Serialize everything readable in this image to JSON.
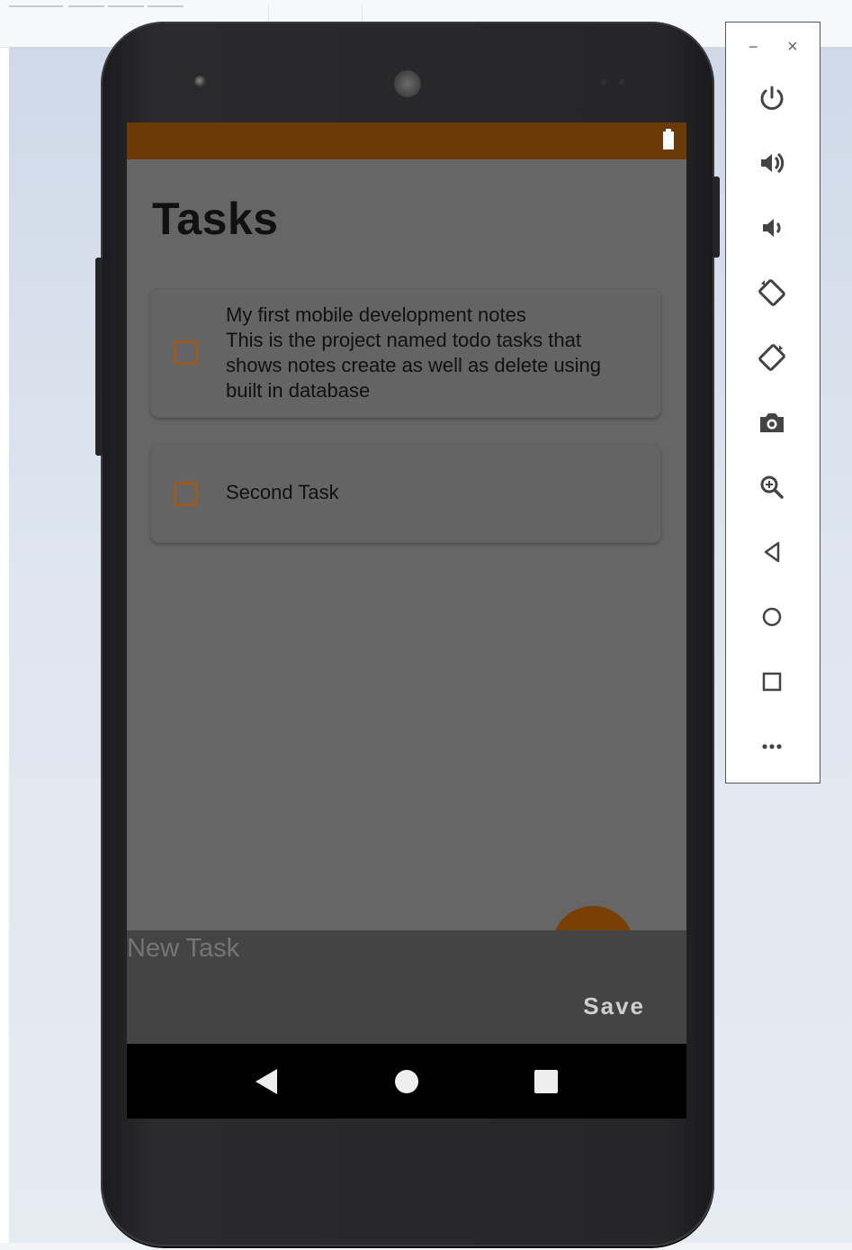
{
  "app": {
    "title": "Tasks",
    "tasks": [
      {
        "checked": false,
        "lines": [
          "My first mobile development notes",
          "This is the project named todo tasks that",
          "shows notes create as well as delete using",
          "built in database"
        ]
      },
      {
        "checked": false,
        "lines": [
          "Second Task"
        ]
      }
    ],
    "new_task": {
      "placeholder": "New Task",
      "value": ""
    },
    "save_label": "Save"
  },
  "toolbar": {
    "minimize": "−",
    "close": "×",
    "tools": [
      "power-icon",
      "volume-up-icon",
      "volume-down-icon",
      "rotate-left-icon",
      "rotate-right-icon",
      "camera-icon",
      "zoom-icon",
      "back-icon",
      "home-icon",
      "overview-icon",
      "more-icon"
    ]
  },
  "colors": {
    "status_bar": "#6b3a06",
    "accent": "#9a5a24",
    "screen_dim": "#666666",
    "sheet": "#444444"
  }
}
